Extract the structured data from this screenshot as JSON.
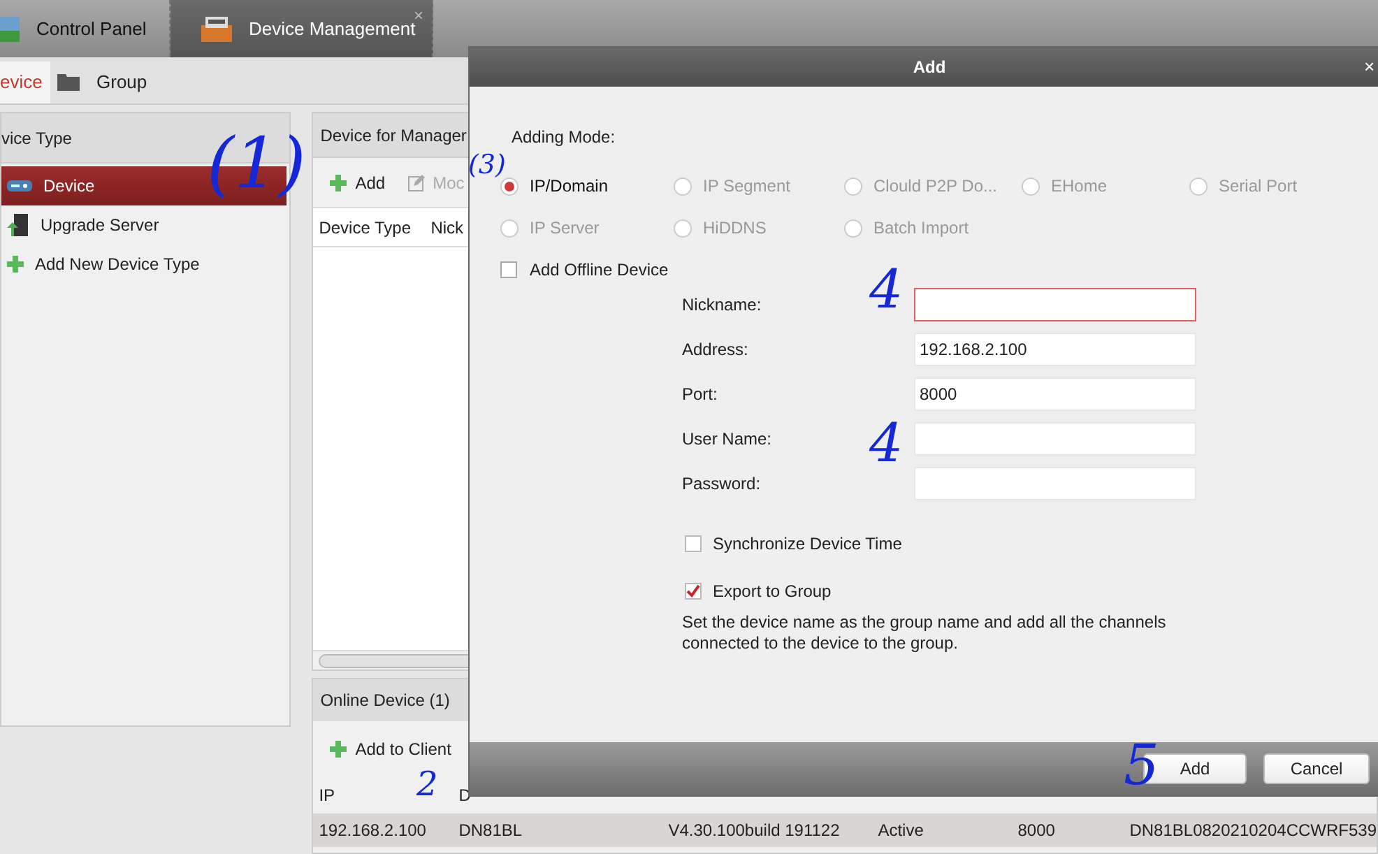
{
  "top_tabs": [
    {
      "label": "Control Panel",
      "selected": false,
      "kind": "panel"
    },
    {
      "label": "Device Management",
      "selected": true,
      "kind": "device",
      "close": "×"
    }
  ],
  "sub_tabs": [
    {
      "label": "evice",
      "selected": true,
      "kind": "device"
    },
    {
      "label": "Group",
      "selected": false,
      "kind": "folder"
    }
  ],
  "device_type_panel": {
    "title": "vice Type",
    "items": [
      {
        "label": "Device",
        "selected": true,
        "kind": "device"
      },
      {
        "label": "Upgrade Server",
        "selected": false,
        "kind": "server"
      },
      {
        "label": "Add New Device Type",
        "selected": false,
        "kind": "add"
      }
    ]
  },
  "managed_panel": {
    "title": "Device for Manager",
    "toolbar": [
      {
        "label": "Add",
        "kind": "add",
        "disabled": false
      },
      {
        "label": "Moc",
        "kind": "edit",
        "disabled": true
      }
    ],
    "columns": [
      "Device Type",
      "Nick"
    ]
  },
  "online_panel": {
    "title": "Online Device (1)",
    "toolbar": [
      {
        "label": "Add to Client",
        "kind": "add"
      }
    ],
    "columns": [
      "IP",
      "D"
    ],
    "rows": [
      {
        "cells": [
          "192.168.2.100",
          "DN81BL",
          "V4.30.100build 191122",
          "Active",
          "8000",
          "DN81BL0820210204CCWRF539"
        ]
      }
    ]
  },
  "dialog": {
    "title": "Add",
    "close": "×",
    "adding_mode_label": "Adding Mode:",
    "modes": [
      {
        "label": "IP/Domain",
        "selected": true
      },
      {
        "label": "IP Segment",
        "selected": false
      },
      {
        "label": "Clould P2P Do...",
        "selected": false
      },
      {
        "label": "EHome",
        "selected": false
      },
      {
        "label": "Serial Port",
        "selected": false
      },
      {
        "label": "IP Server",
        "selected": false
      },
      {
        "label": "HiDDNS",
        "selected": false
      },
      {
        "label": "Batch Import",
        "selected": false
      }
    ],
    "offline": {
      "label": "Add Offline Device",
      "checked": false
    },
    "fields": [
      {
        "label": "Nickname:",
        "error": true
      },
      {
        "label": "Address:",
        "value": "192.168.2.100",
        "error": false
      },
      {
        "label": "Port:",
        "value": "8000",
        "error": false
      },
      {
        "label": "User Name:",
        "error": false
      },
      {
        "label": "Password:",
        "error": false
      }
    ],
    "options": [
      {
        "label": "Synchronize Device Time",
        "checked": false
      },
      {
        "label": "Export to Group",
        "checked": true
      }
    ],
    "note": "Set the device name as the group name and add all the channels connected to the device to the group.",
    "buttons": [
      {
        "label": "Add",
        "kind": "primary"
      },
      {
        "label": "Cancel",
        "kind": "secondary"
      }
    ]
  },
  "annotations": [
    "(1)",
    "(3)",
    "4",
    "4",
    "2",
    "5"
  ]
}
